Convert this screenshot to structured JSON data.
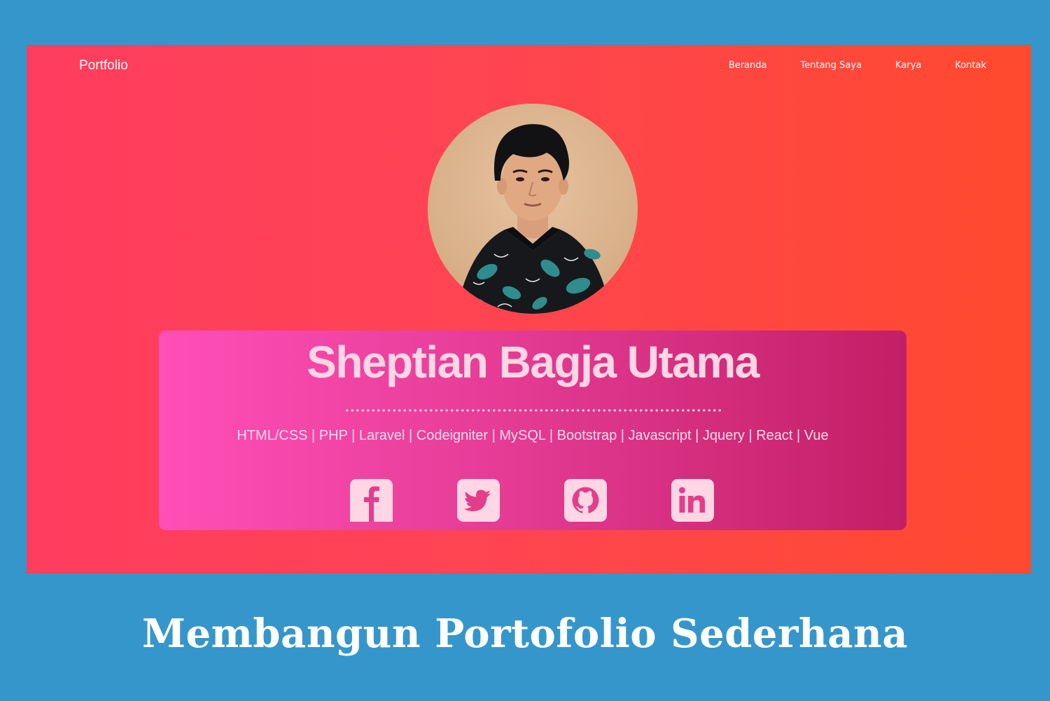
{
  "navbar": {
    "brand": "Portfolio",
    "links": [
      "Beranda",
      "Tentang Saya",
      "Karya",
      "Kontak"
    ]
  },
  "hero": {
    "name": "Sheptian Bagja Utama",
    "skills": "HTML/CSS | PHP | Laravel | Codeigniter | MySQL | Bootstrap | Javascript | Jquery | React | Vue",
    "socials": [
      "facebook-icon",
      "twitter-icon",
      "github-icon",
      "linkedin-icon"
    ]
  },
  "caption": "Membangun Portofolio Sederhana",
  "colors": {
    "page_background": "#3596cb",
    "screen_gradient_start": "#ff3d5f",
    "screen_gradient_end": "#ff4a2e",
    "card_gradient_start": "#ff4fb8",
    "card_gradient_end": "#c21f66",
    "accent_text": "#ffd6e3"
  }
}
